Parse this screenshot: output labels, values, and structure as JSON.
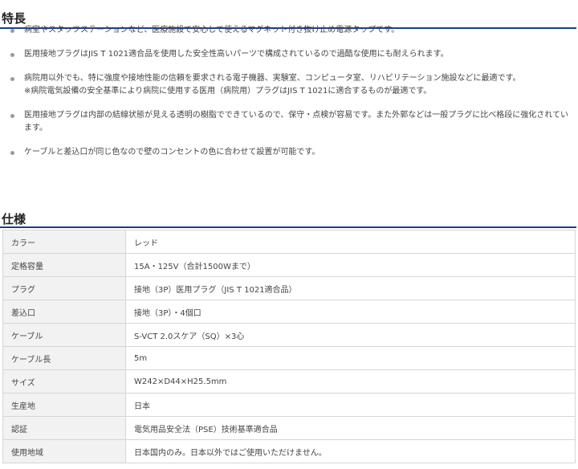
{
  "features": {
    "title": "特長",
    "items": [
      {
        "text": "病室やスタッフステーションなど、医療施設で安心して使えるマグネット付き抜け止め電源タップです。",
        "note": ""
      },
      {
        "text": "医用接地プラグはJIS T 1021適合品を使用した安全性高いパーツで構成されているので過酷な使用にも耐えられます。",
        "note": ""
      },
      {
        "text": "病院用以外でも、特に強度や接地性能の信頼を要求される電子機器、実験室、コンピュータ室、リハビリテーション施設などに最適です。",
        "note": "※病院電気設備の安全基準により病院に使用する医用（病院用）プラグはJIS T 1021に適合するものが最適です。"
      },
      {
        "text": "医用接地プラグは内部の結線状態が見える透明の樹脂でできているので、保守・点検が容易です。また外郭などは一般プラグに比べ格段に強化されています。",
        "note": ""
      },
      {
        "text": "ケーブルと差込口が同じ色なので壁のコンセントの色に合わせて設置が可能です。",
        "note": ""
      }
    ]
  },
  "specs": {
    "title": "仕様",
    "rows": [
      {
        "key": "カラー",
        "value": "レッド"
      },
      {
        "key": "定格容量",
        "value": "15A・125V（合計1500Wまで）"
      },
      {
        "key": "プラグ",
        "value": "接地（3P）医用プラグ（JIS T 1021適合品）"
      },
      {
        "key": "差込口",
        "value": "接地（3P）・4個口"
      },
      {
        "key": "ケーブル",
        "value": "S-VCT 2.0スケア（SQ）×3心"
      },
      {
        "key": "ケーブル長",
        "value": "5m"
      },
      {
        "key": "サイズ",
        "value": "W242×D44×H25.5mm"
      },
      {
        "key": "生産地",
        "value": "日本"
      },
      {
        "key": "認証",
        "value": "電気用品安全法（PSE）技術基準適合品"
      },
      {
        "key": "使用地域",
        "value": "日本国内のみ。日本以外ではご使用いただけません。"
      }
    ]
  }
}
